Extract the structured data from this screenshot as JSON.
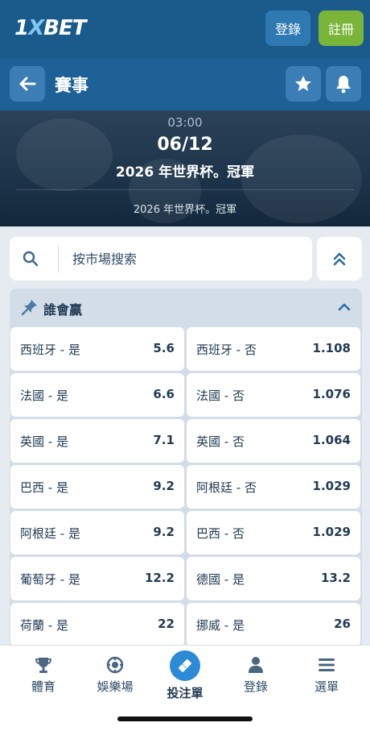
{
  "header": {
    "logo_one": "1",
    "logo_x": "X",
    "logo_bet": "BET",
    "login_label": "登錄",
    "register_label": "註冊"
  },
  "nav": {
    "title": "賽事",
    "back_icon": "arrow-left-icon",
    "favorite_icon": "star-icon",
    "notify_icon": "bell-icon"
  },
  "event": {
    "time": "03:00",
    "date": "06/12",
    "title": "2026 年世界杯。冠軍",
    "subtitle": "2026 年世界杯。冠軍"
  },
  "search": {
    "placeholder": "按市場搜索"
  },
  "market": {
    "title": "誰會贏",
    "rows": [
      {
        "left": {
          "label": "西班牙 - 是",
          "odds": "5.6"
        },
        "right": {
          "label": "西班牙 - 否",
          "odds": "1.108"
        }
      },
      {
        "left": {
          "label": "法國 - 是",
          "odds": "6.6"
        },
        "right": {
          "label": "法國 - 否",
          "odds": "1.076"
        }
      },
      {
        "left": {
          "label": "英國 - 是",
          "odds": "7.1"
        },
        "right": {
          "label": "英國 - 否",
          "odds": "1.064"
        }
      },
      {
        "left": {
          "label": "巴西 - 是",
          "odds": "9.2"
        },
        "right": {
          "label": "阿根廷 - 否",
          "odds": "1.029"
        }
      },
      {
        "left": {
          "label": "阿根廷 - 是",
          "odds": "9.2"
        },
        "right": {
          "label": "巴西 - 否",
          "odds": "1.029"
        }
      },
      {
        "left": {
          "label": "葡萄牙 - 是",
          "odds": "12.2"
        },
        "right": {
          "label": "德國 - 是",
          "odds": "13.2"
        }
      },
      {
        "left": {
          "label": "荷蘭 - 是",
          "odds": "22"
        },
        "right": {
          "label": "挪威 - 是",
          "odds": "26"
        }
      }
    ]
  },
  "tabs": [
    {
      "label": "體育",
      "icon": "trophy-icon"
    },
    {
      "label": "娛樂場",
      "icon": "casino-chip-icon"
    },
    {
      "label": "投注單",
      "icon": "ticket-icon"
    },
    {
      "label": "登錄",
      "icon": "user-icon"
    },
    {
      "label": "選單",
      "icon": "menu-icon"
    }
  ],
  "colors": {
    "header_bg": "#1a5b8c",
    "nav_bg": "#1e6196",
    "register_green": "#7ab439",
    "accent_blue": "#2d8ad6"
  }
}
